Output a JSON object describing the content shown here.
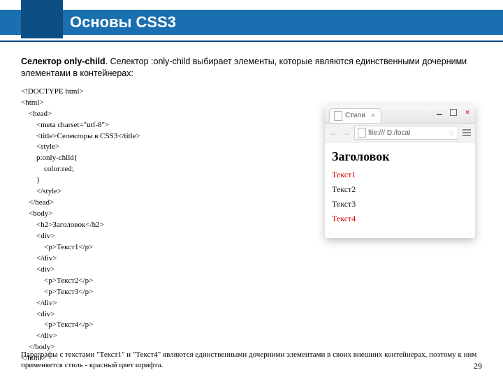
{
  "header": {
    "title": "Основы CSS3"
  },
  "intro": {
    "bold": "Селектор only-child",
    "rest": ". Селектор :only-child выбирает элементы, которые являются единственными дочерними элементами в контейнерах:"
  },
  "code": {
    "l0": "<!DOCTYPE html>",
    "l1": "<html>",
    "l2": "    <head>",
    "l3": "        <meta charset=\"utf-8\">",
    "l4": "        <title>Селекторы в CSS3</title>",
    "l5": "        <style>",
    "l6": "        p:only-child{",
    "l7": "            color:red;",
    "l8": "        }",
    "l9": "        </style>",
    "l10": "    </head>",
    "l11": "    <body>",
    "l12": "        <h2>Заголовок</h2>",
    "l13": "        <div>",
    "l14": "            <p>Текст1</p>",
    "l15": "        </div>",
    "l16": "        <div>",
    "l17": "            <p>Текст2</p>",
    "l18": "            <p>Текст3</p>",
    "l19": "        </div>",
    "l20": "        <div>",
    "l21": "            <p>Текст4</p>",
    "l22": "        </div>",
    "l23": "    </body>",
    "l24": "</html>"
  },
  "browser": {
    "tab_title": "Стили",
    "url_prefix": "file:///",
    "url_path": "D:/local",
    "heading": "Заголовок",
    "p1": "Текст1",
    "p2": "Текст2",
    "p3": "Текст3",
    "p4": "Текст4"
  },
  "footnote": "Параграфы с текстами \"Текст1\" и \"Текст4\" являются единственными дочерними элементами в своих внешних контейнерах, поэтому к ним применяется стиль - красный цвет шрифта.",
  "page": "29"
}
